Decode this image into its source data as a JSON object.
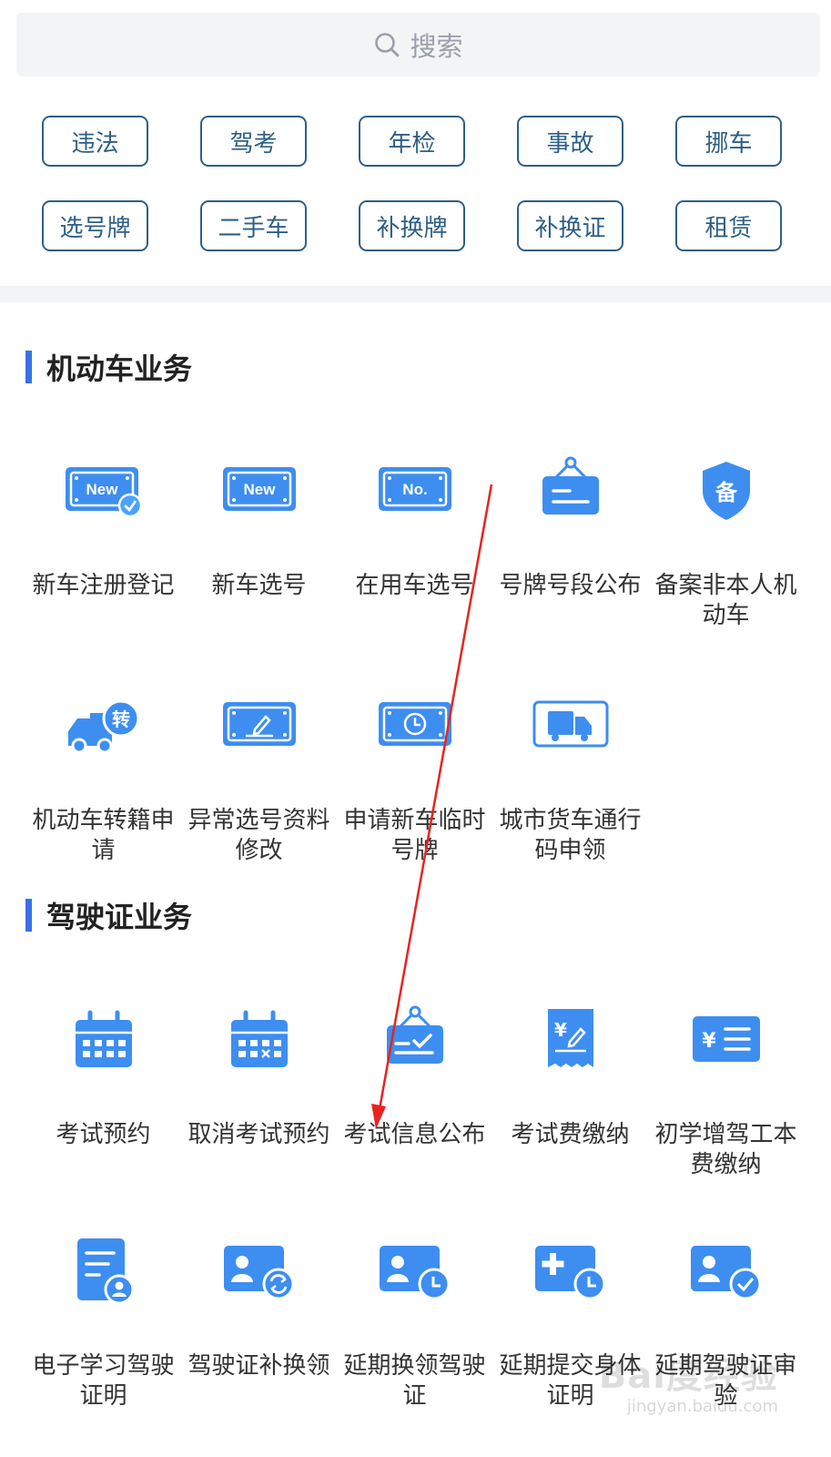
{
  "search": {
    "placeholder": "搜索",
    "icon": "search-icon"
  },
  "quick_tags": [
    "违法",
    "驾考",
    "年检",
    "事故",
    "挪车",
    "选号牌",
    "二手车",
    "补换牌",
    "补换证",
    "租赁"
  ],
  "sections": [
    {
      "title": "机动车业务",
      "items": [
        {
          "label": "新车注册登记",
          "icon": "new-plate-check-icon"
        },
        {
          "label": "新车选号",
          "icon": "new-plate-icon"
        },
        {
          "label": "在用车选号",
          "icon": "number-plate-icon"
        },
        {
          "label": "号牌号段公布",
          "icon": "hanging-board-icon"
        },
        {
          "label": "备案非本人机动车",
          "icon": "shield-record-icon"
        },
        {
          "label": "机动车转籍申请",
          "icon": "transfer-truck-icon"
        },
        {
          "label": "异常选号资料修改",
          "icon": "plate-edit-icon"
        },
        {
          "label": "申请新车临时号牌",
          "icon": "plate-clock-icon"
        },
        {
          "label": "城市货车通行码申领",
          "icon": "truck-pass-icon"
        }
      ]
    },
    {
      "title": "驾驶证业务",
      "items": [
        {
          "label": "考试预约",
          "icon": "calendar-icon"
        },
        {
          "label": "取消考试预约",
          "icon": "calendar-cancel-icon"
        },
        {
          "label": "考试信息公布",
          "icon": "board-check-icon"
        },
        {
          "label": "考试费缴纳",
          "icon": "fee-receipt-icon"
        },
        {
          "label": "初学增驾工本费缴纳",
          "icon": "fee-list-icon"
        },
        {
          "label": "电子学习驾驶证明",
          "icon": "document-user-icon"
        },
        {
          "label": "驾驶证补换领",
          "icon": "license-swap-icon"
        },
        {
          "label": "延期换领驾驶证",
          "icon": "license-clock-icon"
        },
        {
          "label": "延期提交身体证明",
          "icon": "medical-clock-icon"
        },
        {
          "label": "延期驾驶证审验",
          "icon": "license-check-icon"
        }
      ]
    }
  ],
  "watermark": {
    "logo_text": "Bai度经验",
    "url_text": "jingyan.baidu.com"
  },
  "colors": {
    "accent": "#3a6fe6",
    "chip_border": "#2e5f85",
    "icon_blue": "#3d8ef0",
    "arrow": "#e8231f"
  }
}
